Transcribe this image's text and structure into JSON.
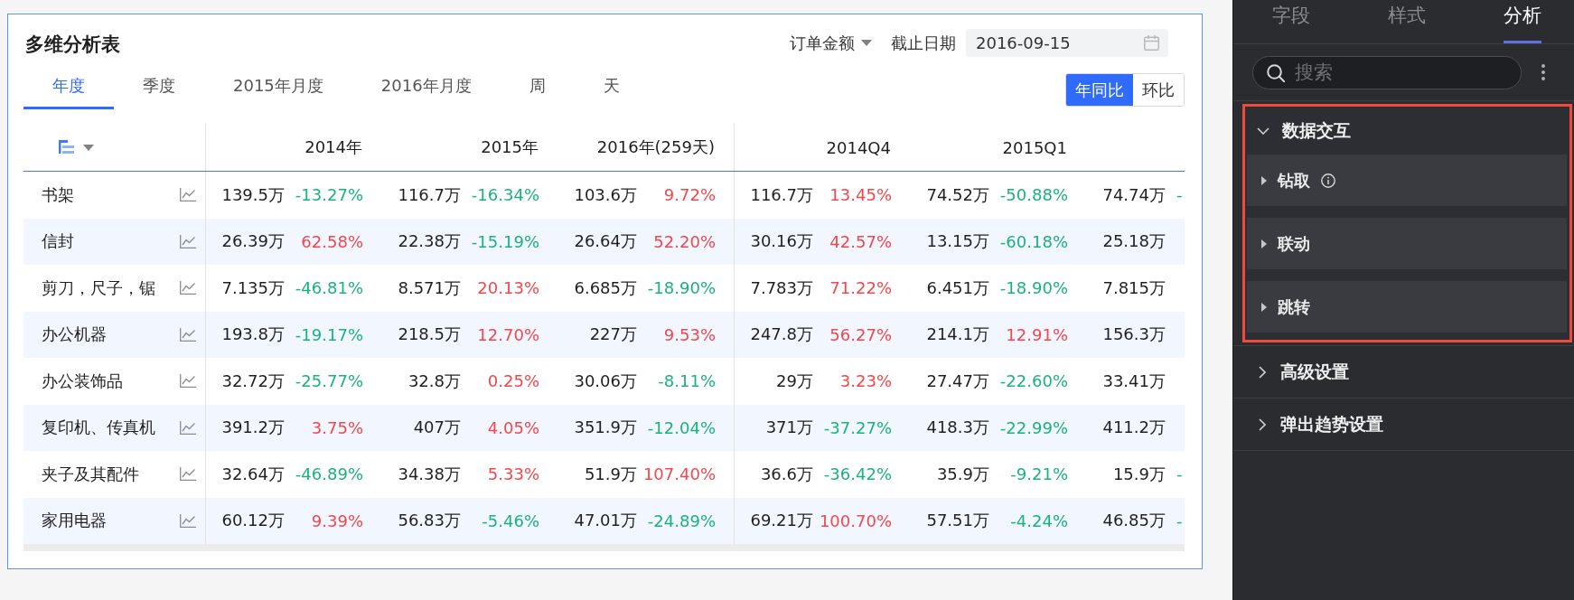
{
  "card": {
    "title": "多维分析表",
    "measure": {
      "label": "订单金额"
    },
    "date_filter": {
      "label": "截止日期",
      "value": "2016-09-15"
    },
    "tabs": [
      {
        "label": "年度",
        "selected": true
      },
      {
        "label": "季度",
        "selected": false
      },
      {
        "label": "2015年月度",
        "selected": false
      },
      {
        "label": "2016年月度",
        "selected": false
      },
      {
        "label": "周",
        "selected": false
      },
      {
        "label": "天",
        "selected": false
      }
    ],
    "compare": [
      {
        "label": "年同比",
        "selected": true
      },
      {
        "label": "环比",
        "selected": false
      }
    ],
    "table": {
      "column_groups": [
        {
          "headers": [
            "2014年",
            "2015年",
            "2016年(259天)"
          ]
        },
        {
          "headers": [
            "2014Q4",
            "2015Q1"
          ]
        }
      ],
      "rows": [
        {
          "name": "书架",
          "cells": [
            {
              "value": "139.5万",
              "change": "-13.27%",
              "color": "#1bb27c"
            },
            {
              "value": "116.7万",
              "change": "-16.34%",
              "color": "#1bb27c"
            },
            {
              "value": "103.6万",
              "change": "9.72%",
              "color": "#f2474b"
            },
            {
              "value": "116.7万",
              "change": "13.45%",
              "color": "#f2474b"
            },
            {
              "value": "74.52万",
              "change": "-50.88%",
              "color": "#1bb27c"
            },
            {
              "value": "74.74万",
              "change": "-",
              "color": "#1bb27c"
            }
          ]
        },
        {
          "name": "信封",
          "cells": [
            {
              "value": "26.39万",
              "change": "62.58%",
              "color": "#f2474b"
            },
            {
              "value": "22.38万",
              "change": "-15.19%",
              "color": "#1bb27c"
            },
            {
              "value": "26.64万",
              "change": "52.20%",
              "color": "#f2474b"
            },
            {
              "value": "30.16万",
              "change": "42.57%",
              "color": "#f2474b"
            },
            {
              "value": "13.15万",
              "change": "-60.18%",
              "color": "#1bb27c"
            },
            {
              "value": "25.18万"
            }
          ]
        },
        {
          "name": "剪刀，尺子，锯",
          "cells": [
            {
              "value": "7.135万",
              "change": "-46.81%",
              "color": "#1bb27c"
            },
            {
              "value": "8.571万",
              "change": "20.13%",
              "color": "#f2474b"
            },
            {
              "value": "6.685万",
              "change": "-18.90%",
              "color": "#1bb27c"
            },
            {
              "value": "7.783万",
              "change": "71.22%",
              "color": "#f2474b"
            },
            {
              "value": "6.451万",
              "change": "-18.90%",
              "color": "#1bb27c"
            },
            {
              "value": "7.815万"
            }
          ]
        },
        {
          "name": "办公机器",
          "cells": [
            {
              "value": "193.8万",
              "change": "-19.17%",
              "color": "#1bb27c"
            },
            {
              "value": "218.5万",
              "change": "12.70%",
              "color": "#f2474b"
            },
            {
              "value": "227万",
              "change": "9.53%",
              "color": "#f2474b"
            },
            {
              "value": "247.8万",
              "change": "56.27%",
              "color": "#f2474b"
            },
            {
              "value": "214.1万",
              "change": "12.91%",
              "color": "#f2474b"
            },
            {
              "value": "156.3万"
            }
          ]
        },
        {
          "name": "办公装饰品",
          "cells": [
            {
              "value": "32.72万",
              "change": "-25.77%",
              "color": "#1bb27c"
            },
            {
              "value": "32.8万",
              "change": "0.25%",
              "color": "#f2474b"
            },
            {
              "value": "30.06万",
              "change": "-8.11%",
              "color": "#1bb27c"
            },
            {
              "value": "29万",
              "change": "3.23%",
              "color": "#f2474b"
            },
            {
              "value": "27.47万",
              "change": "-22.60%",
              "color": "#1bb27c"
            },
            {
              "value": "33.41万"
            }
          ]
        },
        {
          "name": "复印机、传真机",
          "cells": [
            {
              "value": "391.2万",
              "change": "3.75%",
              "color": "#f2474b"
            },
            {
              "value": "407万",
              "change": "4.05%",
              "color": "#f2474b"
            },
            {
              "value": "351.9万",
              "change": "-12.04%",
              "color": "#1bb27c"
            },
            {
              "value": "371万",
              "change": "-37.27%",
              "color": "#1bb27c"
            },
            {
              "value": "418.3万",
              "change": "-22.99%",
              "color": "#1bb27c"
            },
            {
              "value": "411.2万"
            }
          ]
        },
        {
          "name": "夹子及其配件",
          "cells": [
            {
              "value": "32.64万",
              "change": "-46.89%",
              "color": "#1bb27c"
            },
            {
              "value": "34.38万",
              "change": "5.33%",
              "color": "#f2474b"
            },
            {
              "value": "51.9万",
              "change": "107.40%",
              "color": "#f2474b"
            },
            {
              "value": "36.6万",
              "change": "-36.42%",
              "color": "#1bb27c"
            },
            {
              "value": "35.9万",
              "change": "-9.21%",
              "color": "#1bb27c"
            },
            {
              "value": "15.9万",
              "change": "-",
              "color": "#1bb27c"
            }
          ]
        },
        {
          "name": "家用电器",
          "cells": [
            {
              "value": "60.12万",
              "change": "9.39%",
              "color": "#f2474b"
            },
            {
              "value": "56.83万",
              "change": "-5.46%",
              "color": "#1bb27c"
            },
            {
              "value": "47.01万",
              "change": "-24.89%",
              "color": "#1bb27c"
            },
            {
              "value": "69.21万",
              "change": "100.70%",
              "color": "#f2474b"
            },
            {
              "value": "57.51万",
              "change": "-4.24%",
              "color": "#1bb27c"
            },
            {
              "value": "46.85万",
              "change": "-",
              "color": "#1bb27c"
            }
          ]
        }
      ]
    }
  },
  "side_panel": {
    "tabs": [
      {
        "label": "字段",
        "selected": false
      },
      {
        "label": "样式",
        "selected": false
      },
      {
        "label": "分析",
        "selected": true
      }
    ],
    "search": {
      "placeholder": "搜索"
    },
    "sections": [
      {
        "title": "数据交互",
        "expanded": true,
        "highlighted": true,
        "children": [
          {
            "label": "钻取",
            "info": true,
            "expanded": false
          },
          {
            "label": "联动",
            "info": false,
            "expanded": false
          },
          {
            "label": "跳转",
            "info": false,
            "expanded": false
          }
        ]
      },
      {
        "title": "高级设置",
        "expanded": false,
        "highlighted": false
      },
      {
        "title": "弹出趋势设置",
        "expanded": false,
        "highlighted": false
      }
    ]
  }
}
